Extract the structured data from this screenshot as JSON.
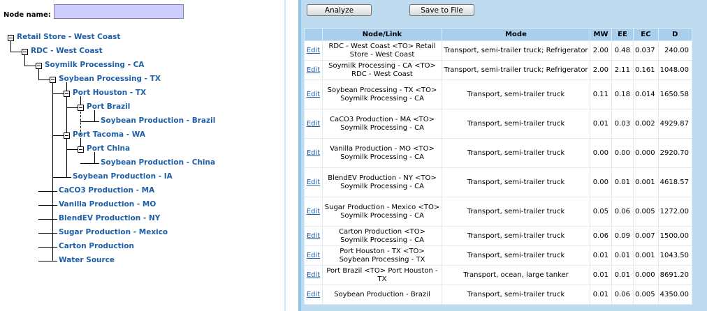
{
  "left_panel": {
    "node_name_label": "Node name:",
    "node_name_value": "",
    "tree": [
      {
        "label": "Retail Store - West Coast"
      },
      {
        "label": "RDC - West Coast"
      },
      {
        "label": "Soymilk Processing - CA"
      },
      {
        "label": "Soybean Processing - TX"
      },
      {
        "label": "Port Houston - TX"
      },
      {
        "label": "Port Brazil"
      },
      {
        "label": "Soybean Production - Brazil"
      },
      {
        "label": "Port Tacoma - WA"
      },
      {
        "label": "Port China"
      },
      {
        "label": "Soybean Production - China"
      },
      {
        "label": "Soybean Production - IA"
      },
      {
        "label": "CaCO3 Production - MA"
      },
      {
        "label": "Vanilla Production - MO"
      },
      {
        "label": "BlendEV Production - NY"
      },
      {
        "label": "Sugar Production - Mexico"
      },
      {
        "label": "Carton Production"
      },
      {
        "label": "Water Source"
      }
    ]
  },
  "toolbar": {
    "analyze_label": "Analyze",
    "save_label": "Save to File"
  },
  "table": {
    "headers": [
      "",
      "Node/Link",
      "Mode",
      "MW",
      "EE",
      "EC",
      "D"
    ],
    "edit_label": "Edit",
    "rows": [
      {
        "link": "RDC - West Coast <TO> Retail Store - West Coast",
        "mode": "Transport, semi-trailer truck; Refrigerator",
        "mw": "2.00",
        "ee": "0.48",
        "ec": "0.037",
        "d": "240.00"
      },
      {
        "link": "Soymilk Processing - CA <TO> RDC - West Coast",
        "mode": "Transport, semi-trailer truck; Refrigerator",
        "mw": "2.00",
        "ee": "2.11",
        "ec": "0.161",
        "d": "1048.00"
      },
      {
        "link": "Soybean Processing - TX <TO> Soymilk Processing - CA",
        "mode": "Transport, semi-trailer truck",
        "mw": "0.11",
        "ee": "0.18",
        "ec": "0.014",
        "d": "1650.58"
      },
      {
        "link": "CaCO3 Production - MA <TO> Soymilk Processing - CA",
        "mode": "Transport, semi-trailer truck",
        "mw": "0.01",
        "ee": "0.03",
        "ec": "0.002",
        "d": "4929.87"
      },
      {
        "link": "Vanilla Production - MO <TO> Soymilk Processing - CA",
        "mode": "Transport, semi-trailer truck",
        "mw": "0.00",
        "ee": "0.00",
        "ec": "0.000",
        "d": "2920.70"
      },
      {
        "link": "BlendEV Production - NY <TO> Soymilk Processing - CA",
        "mode": "Transport, semi-trailer truck",
        "mw": "0.00",
        "ee": "0.01",
        "ec": "0.001",
        "d": "4618.57"
      },
      {
        "link": "Sugar Production - Mexico <TO> Soymilk Processing - CA",
        "mode": "Transport, semi-trailer truck",
        "mw": "0.05",
        "ee": "0.06",
        "ec": "0.005",
        "d": "1272.00"
      },
      {
        "link": "Carton Production <TO> Soymilk Processing - CA",
        "mode": "Transport, semi-trailer truck",
        "mw": "0.06",
        "ee": "0.09",
        "ec": "0.007",
        "d": "1500.00"
      },
      {
        "link": "Port Houston - TX <TO> Soybean Processing - TX",
        "mode": "Transport, semi-trailer truck",
        "mw": "0.01",
        "ee": "0.01",
        "ec": "0.001",
        "d": "1043.50"
      },
      {
        "link": "Port Brazil <TO> Port Houston - TX",
        "mode": "Transport, ocean, large tanker",
        "mw": "0.01",
        "ee": "0.01",
        "ec": "0.000",
        "d": "8691.20"
      },
      {
        "link": "Soybean Production - Brazil",
        "mode": "Transport, semi-trailer truck",
        "mw": "0.01",
        "ee": "0.06",
        "ec": "0.005",
        "d": "4350.00"
      }
    ]
  }
}
